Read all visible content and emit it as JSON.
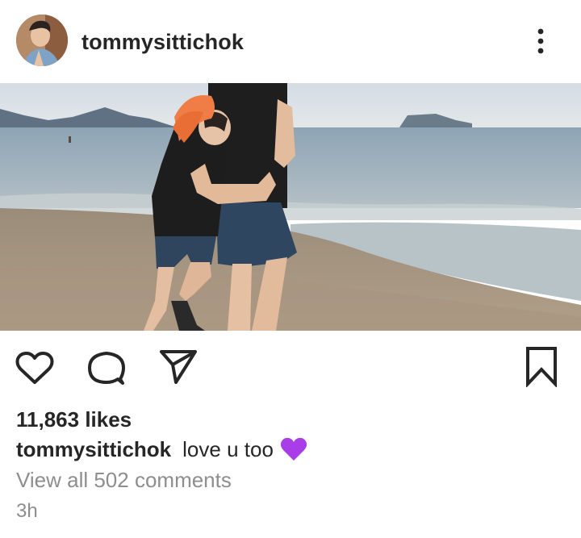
{
  "post": {
    "username": "tommysittichok",
    "caption_text": "love u too",
    "caption_emoji": "purple-heart",
    "likes_text": "11,863 likes",
    "comments_text": "View all 502 comments",
    "time_text": "3h"
  },
  "colors": {
    "text": "#262626",
    "secondary": "#8e8e8e",
    "heart": "#a93ee8"
  },
  "icons": {
    "more": "more-vertical-icon",
    "like": "heart-outline-icon",
    "comment": "comment-bubble-icon",
    "share": "paper-plane-icon",
    "save": "bookmark-icon"
  }
}
